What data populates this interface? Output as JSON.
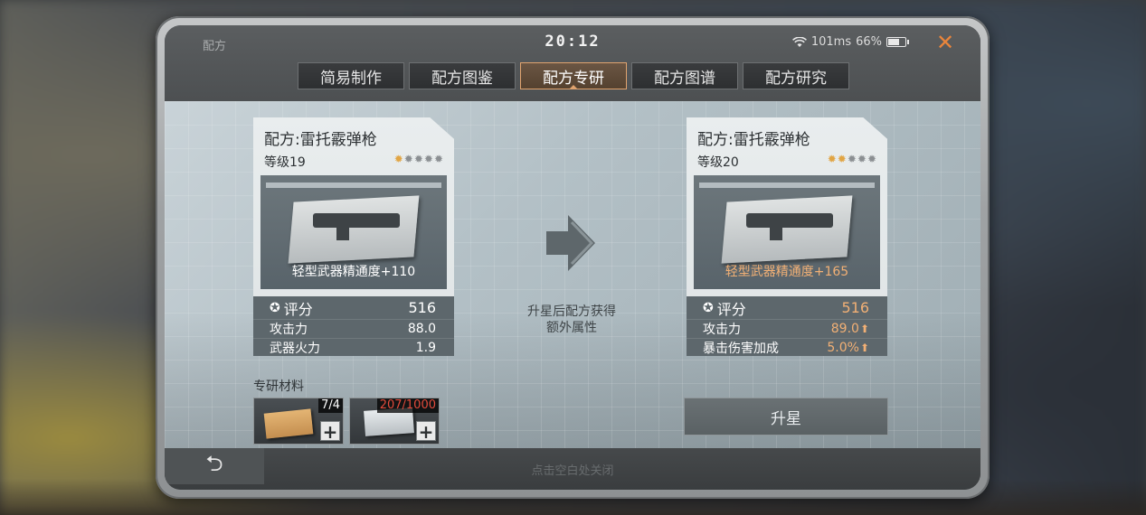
{
  "header": {
    "app_title": "配方",
    "time": "20:12",
    "ping": "101ms",
    "battery": "66%",
    "close_icon": "close-icon"
  },
  "tabs": [
    {
      "label": "简易制作",
      "active": false
    },
    {
      "label": "配方图鉴",
      "active": false
    },
    {
      "label": "配方专研",
      "active": true
    },
    {
      "label": "配方图谱",
      "active": false
    },
    {
      "label": "配方研究",
      "active": false
    }
  ],
  "current": {
    "title": "配方:雷托霰弹枪",
    "level": "等级19",
    "stars_lit": 1,
    "stars_total": 5,
    "image_label": "轻型武器精通度+110",
    "score_label": "评分",
    "score_value": "516",
    "stats": [
      {
        "name": "攻击力",
        "value": "88.0"
      },
      {
        "name": "武器火力",
        "value": "1.9"
      }
    ]
  },
  "next": {
    "title": "配方:雷托霰弹枪",
    "level": "等级20",
    "stars_lit": 2,
    "stars_total": 5,
    "image_label": "轻型武器精通度+165",
    "score_label": "评分",
    "score_value": "516",
    "stats": [
      {
        "name": "攻击力",
        "value": "89.0"
      },
      {
        "name": "暴击伤害加成",
        "value": "5.0%"
      }
    ]
  },
  "upgrade_hint_line1": "升星后配方获得",
  "upgrade_hint_line2": "额外属性",
  "materials": {
    "label": "专研材料",
    "items": [
      {
        "count": "7/4"
      },
      {
        "count": "207/1000"
      }
    ]
  },
  "starup_button": "升星",
  "footer": {
    "close_hint": "点击空白处关闭"
  },
  "colors": {
    "accent_orange": "#e9853b",
    "bonus_orange": "#f2b075",
    "insufficient_red": "#e24a3b"
  }
}
